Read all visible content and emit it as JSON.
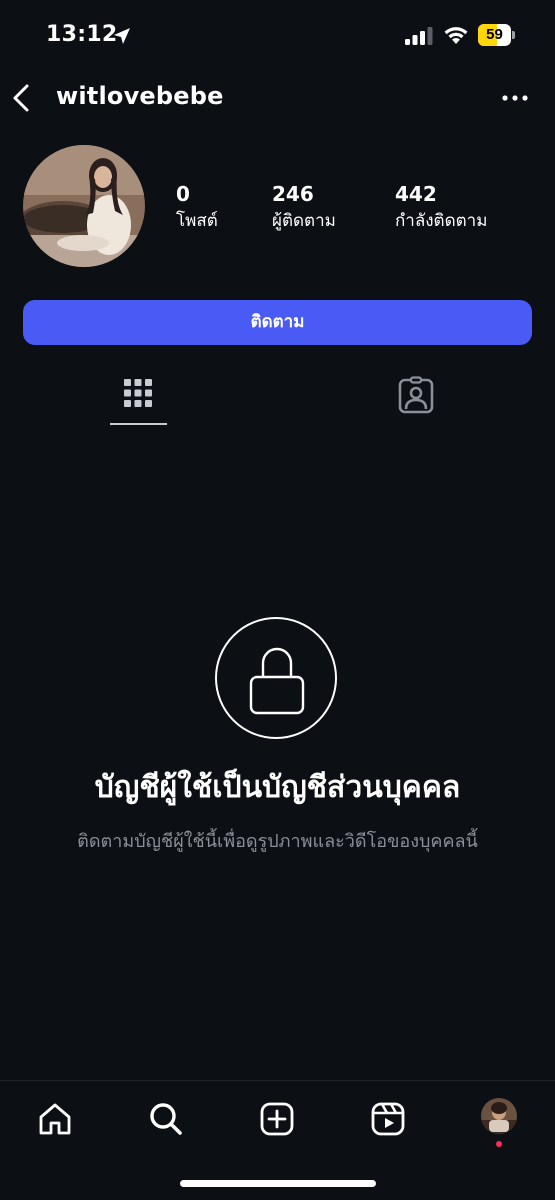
{
  "status_bar": {
    "time": "13:12",
    "battery_level": "59",
    "battery_fraction": 0.59,
    "icons": [
      "location-arrow-icon",
      "cellular-signal-icon",
      "wifi-icon",
      "battery-icon"
    ]
  },
  "header": {
    "username": "witlovebebe",
    "back_icon": "chevron-left-icon",
    "more_icon": "more-horizontal-icon"
  },
  "profile": {
    "stats": [
      {
        "number": "0",
        "label": "โพสต์"
      },
      {
        "number": "246",
        "label": "ผู้ติดตาม"
      },
      {
        "number": "442",
        "label": "กำลังติดตาม"
      }
    ],
    "follow_label": "ติดตาม"
  },
  "tabs": [
    {
      "icon": "grid-icon",
      "selected": true
    },
    {
      "icon": "tagged-person-icon",
      "selected": false
    }
  ],
  "private": {
    "icon": "lock-icon",
    "title": "บัญชีผู้ใช้เป็นบัญชีส่วนบุคคล",
    "description": "ติดตามบัญชีผู้ใช้นี้เพื่อดูรูปภาพและวิดีโอของบุคคลนี้"
  },
  "bottom_nav": {
    "items": [
      "home-icon",
      "search-icon",
      "create-icon",
      "reels-icon",
      "profile-avatar"
    ]
  },
  "colors": {
    "background": "#0c0f14",
    "primary_button": "#4a5bf5",
    "muted_text": "#8a8f98",
    "battery_fill": "#ffd60a",
    "notification_dot": "#ff2d55"
  }
}
